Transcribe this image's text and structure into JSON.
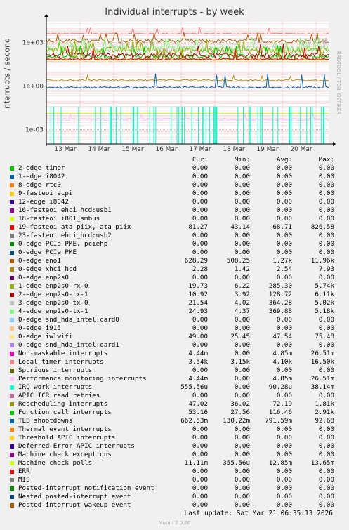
{
  "chart_data": {
    "type": "line",
    "title": "Individual interrupts - by week",
    "ylabel": "interrupts / second",
    "y_scale": "log",
    "ylim": [
      0.0001,
      30000
    ],
    "y_ticks": [
      "1e+03",
      "1e+00",
      "1e-03"
    ],
    "x_ticks": [
      "13 Mar",
      "14 Mar",
      "15 Mar",
      "16 Mar",
      "17 Mar",
      "18 Mar",
      "19 Mar",
      "20 Mar"
    ],
    "grid": true,
    "legend_placement": "bottom",
    "columns": [
      "Cur:",
      "Min:",
      "Avg:",
      "Max:"
    ],
    "series": [
      {
        "name": "2-edge      timer",
        "color": "#00cc00",
        "cur": "0.00",
        "min": "0.00",
        "avg": "0.00",
        "max": "0.00"
      },
      {
        "name": "1-edge      i8042",
        "color": "#0066b3",
        "cur": "0.00",
        "min": "0.00",
        "avg": "0.00",
        "max": "0.00"
      },
      {
        "name": "8-edge      rtc0",
        "color": "#ff8000",
        "cur": "0.00",
        "min": "0.00",
        "avg": "0.00",
        "max": "0.00"
      },
      {
        "name": "9-fasteoi   acpi",
        "color": "#ffcc00",
        "cur": "0.00",
        "min": "0.00",
        "avg": "0.00",
        "max": "0.00"
      },
      {
        "name": "12-edge      i8042",
        "color": "#330099",
        "cur": "0.00",
        "min": "0.00",
        "avg": "0.00",
        "max": "0.00"
      },
      {
        "name": "16-fasteoi   ehci_hcd:usb1",
        "color": "#990099",
        "cur": "0.00",
        "min": "0.00",
        "avg": "0.00",
        "max": "0.00"
      },
      {
        "name": "18-fasteoi   i801_smbus",
        "color": "#ccff00",
        "cur": "0.00",
        "min": "0.00",
        "avg": "0.00",
        "max": "0.00"
      },
      {
        "name": "19-fasteoi   ata_piix, ata_piix",
        "color": "#ff0000",
        "cur": "81.27",
        "min": "43.14",
        "avg": "68.71",
        "max": "826.58"
      },
      {
        "name": "23-fasteoi   ehci_hcd:usb2",
        "color": "#808080",
        "cur": "0.00",
        "min": "0.00",
        "avg": "0.00",
        "max": "0.00"
      },
      {
        "name": "0-edge      PCIe PME, pciehp",
        "color": "#008f00",
        "cur": "0.00",
        "min": "0.00",
        "avg": "0.00",
        "max": "0.00"
      },
      {
        "name": "0-edge      PCIe PME",
        "color": "#00487d",
        "cur": "0.00",
        "min": "0.00",
        "avg": "0.00",
        "max": "0.00"
      },
      {
        "name": "0-edge      eno1",
        "color": "#b35a00",
        "cur": "628.29",
        "min": "508.25",
        "avg": "1.27k",
        "max": "11.96k"
      },
      {
        "name": "0-edge      xhci_hcd",
        "color": "#b38f00",
        "cur": "2.28",
        "min": "1.42",
        "avg": "2.54",
        "max": "7.93"
      },
      {
        "name": "0-edge      enp2s0",
        "color": "#6b006b",
        "cur": "0.00",
        "min": "0.00",
        "avg": "0.00",
        "max": "0.00"
      },
      {
        "name": "1-edge      enp2s0-rx-0",
        "color": "#8fb300",
        "cur": "19.73",
        "min": "6.22",
        "avg": "285.30",
        "max": "5.74k"
      },
      {
        "name": "2-edge      enp2s0-rx-1",
        "color": "#b30000",
        "cur": "10.92",
        "min": "3.92",
        "avg": "128.72",
        "max": "6.11k"
      },
      {
        "name": "3-edge      enp2s0-tx-0",
        "color": "#bebebe",
        "cur": "21.54",
        "min": "4.02",
        "avg": "364.28",
        "max": "5.02k"
      },
      {
        "name": "4-edge      enp2s0-tx-1",
        "color": "#80ff80",
        "cur": "24.93",
        "min": "4.37",
        "avg": "369.88",
        "max": "5.18k"
      },
      {
        "name": "0-edge      snd_hda_intel:card0",
        "color": "#80c9ff",
        "cur": "0.00",
        "min": "0.00",
        "avg": "0.00",
        "max": "0.00"
      },
      {
        "name": "0-edge      i915",
        "color": "#ffc080",
        "cur": "0.00",
        "min": "0.00",
        "avg": "0.00",
        "max": "0.00"
      },
      {
        "name": "0-edge      iwlwifi",
        "color": "#ffe680",
        "cur": "49.00",
        "min": "25.45",
        "avg": "47.54",
        "max": "75.48"
      },
      {
        "name": "0-edge      snd_hda_intel:card1",
        "color": "#aa80ff",
        "cur": "0.00",
        "min": "0.00",
        "avg": "0.00",
        "max": "0.00"
      },
      {
        "name": "Non-maskable interrupts",
        "color": "#ee00cc",
        "cur": "4.44m",
        "min": "0.00",
        "avg": "4.85m",
        "max": "26.51m"
      },
      {
        "name": "Local timer interrupts",
        "color": "#ff8080",
        "cur": "3.54k",
        "min": "3.15k",
        "avg": "4.10k",
        "max": "16.50k"
      },
      {
        "name": "Spurious interrupts",
        "color": "#666600",
        "cur": "0.00",
        "min": "0.00",
        "avg": "0.00",
        "max": "0.00"
      },
      {
        "name": "Performance monitoring interrupts",
        "color": "#ffbfff",
        "cur": "4.44m",
        "min": "0.00",
        "avg": "4.85m",
        "max": "26.51m"
      },
      {
        "name": "IRQ work interrupts",
        "color": "#00ffcc",
        "cur": "555.56u",
        "min": "0.00",
        "avg": "90.28u",
        "max": "38.14m"
      },
      {
        "name": "APIC ICR read retries",
        "color": "#cc6699",
        "cur": "0.00",
        "min": "0.00",
        "avg": "0.00",
        "max": "0.00"
      },
      {
        "name": "Rescheduling interrupts",
        "color": "#999900",
        "cur": "47.02",
        "min": "36.02",
        "avg": "72.19",
        "max": "1.81k"
      },
      {
        "name": "Function call interrupts",
        "color": "#00cc00",
        "cur": "53.16",
        "min": "27.56",
        "avg": "116.46",
        "max": "2.91k"
      },
      {
        "name": "TLB shootdowns",
        "color": "#0066b3",
        "cur": "662.53m",
        "min": "130.22m",
        "avg": "791.59m",
        "max": "92.68"
      },
      {
        "name": "Thermal event interrupts",
        "color": "#ff8000",
        "cur": "0.00",
        "min": "0.00",
        "avg": "0.00",
        "max": "0.00"
      },
      {
        "name": "Threshold APIC interrupts",
        "color": "#ffcc00",
        "cur": "0.00",
        "min": "0.00",
        "avg": "0.00",
        "max": "0.00"
      },
      {
        "name": "Deferred Error APIC interrupts",
        "color": "#330099",
        "cur": "0.00",
        "min": "0.00",
        "avg": "0.00",
        "max": "0.00"
      },
      {
        "name": "Machine check exceptions",
        "color": "#990099",
        "cur": "0.00",
        "min": "0.00",
        "avg": "0.00",
        "max": "0.00"
      },
      {
        "name": "Machine check polls",
        "color": "#ccff00",
        "cur": "11.11m",
        "min": "355.56u",
        "avg": "12.85m",
        "max": "13.65m"
      },
      {
        "name": "ERR",
        "color": "#ff0000",
        "cur": "0.00",
        "min": "0.00",
        "avg": "0.00",
        "max": "0.00"
      },
      {
        "name": "MIS",
        "color": "#808080",
        "cur": "0.00",
        "min": "0.00",
        "avg": "0.00",
        "max": "0.00"
      },
      {
        "name": "Posted-interrupt notification event",
        "color": "#008f00",
        "cur": "0.00",
        "min": "0.00",
        "avg": "0.00",
        "max": "0.00"
      },
      {
        "name": "Nested posted-interrupt event",
        "color": "#00487d",
        "cur": "0.00",
        "min": "0.00",
        "avg": "0.00",
        "max": "0.00"
      },
      {
        "name": "Posted-interrupt wakeup event",
        "color": "#b35a00",
        "cur": "0.00",
        "min": "0.00",
        "avg": "0.00",
        "max": "0.00"
      }
    ]
  },
  "footer": {
    "last_update": "Last update: Sat Mar 21 06:35:13 2026",
    "munin_version": "Munin 2.0.76",
    "watermark": "RRDTOOL / TOBI OETIKER"
  }
}
